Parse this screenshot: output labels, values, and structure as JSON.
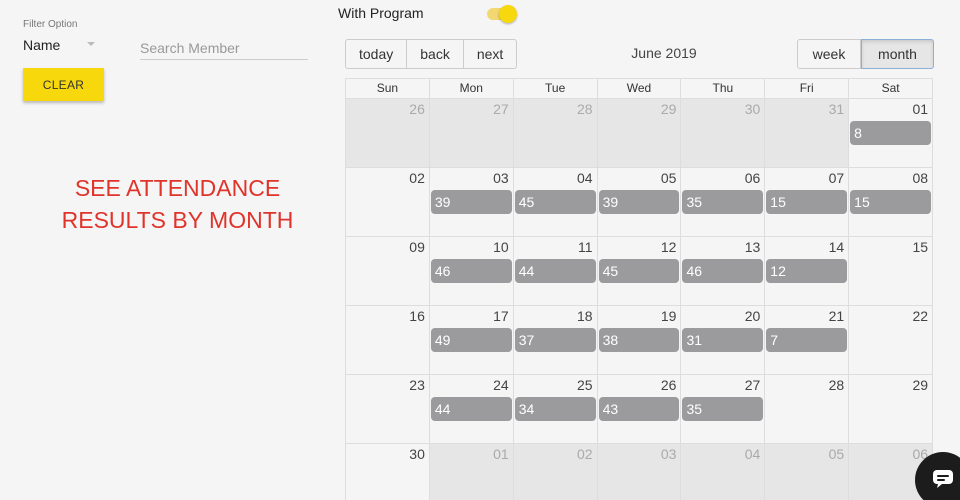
{
  "filter": {
    "label": "Filter Option",
    "selected": "Name"
  },
  "search": {
    "placeholder": "Search Member",
    "value": ""
  },
  "clear_label": "CLEAR",
  "promo": {
    "line1": "SEE ATTENDANCE",
    "line2": "RESULTS BY MONTH"
  },
  "toggle": {
    "label": "With Program",
    "on": true
  },
  "toolbar": {
    "today": "today",
    "back": "back",
    "next": "next",
    "title": "June 2019",
    "week": "week",
    "month": "month",
    "active_view": "month"
  },
  "calendar": {
    "days_of_week": [
      "Sun",
      "Mon",
      "Tue",
      "Wed",
      "Thu",
      "Fri",
      "Sat"
    ],
    "weeks": [
      [
        {
          "d": "26",
          "off": true
        },
        {
          "d": "27",
          "off": true
        },
        {
          "d": "28",
          "off": true
        },
        {
          "d": "29",
          "off": true
        },
        {
          "d": "30",
          "off": true
        },
        {
          "d": "31",
          "off": true
        },
        {
          "d": "01",
          "e": "8"
        }
      ],
      [
        {
          "d": "02"
        },
        {
          "d": "03",
          "e": "39"
        },
        {
          "d": "04",
          "e": "45"
        },
        {
          "d": "05",
          "e": "39"
        },
        {
          "d": "06",
          "e": "35"
        },
        {
          "d": "07",
          "e": "15"
        },
        {
          "d": "08",
          "e": "15"
        }
      ],
      [
        {
          "d": "09"
        },
        {
          "d": "10",
          "e": "46"
        },
        {
          "d": "11",
          "e": "44"
        },
        {
          "d": "12",
          "e": "45"
        },
        {
          "d": "13",
          "e": "46"
        },
        {
          "d": "14",
          "e": "12"
        },
        {
          "d": "15"
        }
      ],
      [
        {
          "d": "16"
        },
        {
          "d": "17",
          "e": "49"
        },
        {
          "d": "18",
          "e": "37"
        },
        {
          "d": "19",
          "e": "38"
        },
        {
          "d": "20",
          "e": "31"
        },
        {
          "d": "21",
          "e": "7"
        },
        {
          "d": "22"
        }
      ],
      [
        {
          "d": "23"
        },
        {
          "d": "24",
          "e": "44"
        },
        {
          "d": "25",
          "e": "34"
        },
        {
          "d": "26",
          "e": "43"
        },
        {
          "d": "27",
          "e": "35"
        },
        {
          "d": "28"
        },
        {
          "d": "29"
        }
      ],
      [
        {
          "d": "30"
        },
        {
          "d": "01",
          "off": true
        },
        {
          "d": "02",
          "off": true
        },
        {
          "d": "03",
          "off": true
        },
        {
          "d": "04",
          "off": true
        },
        {
          "d": "05",
          "off": true
        },
        {
          "d": "06",
          "off": true
        }
      ]
    ]
  },
  "colors": {
    "accent": "#f7d80d",
    "event": "#9b9b9e",
    "promo": "#e0342b",
    "off_day": "#e6e6e6"
  },
  "icons": {
    "chat": "chat-bubble-icon",
    "dropdown": "chevron-down-icon"
  }
}
